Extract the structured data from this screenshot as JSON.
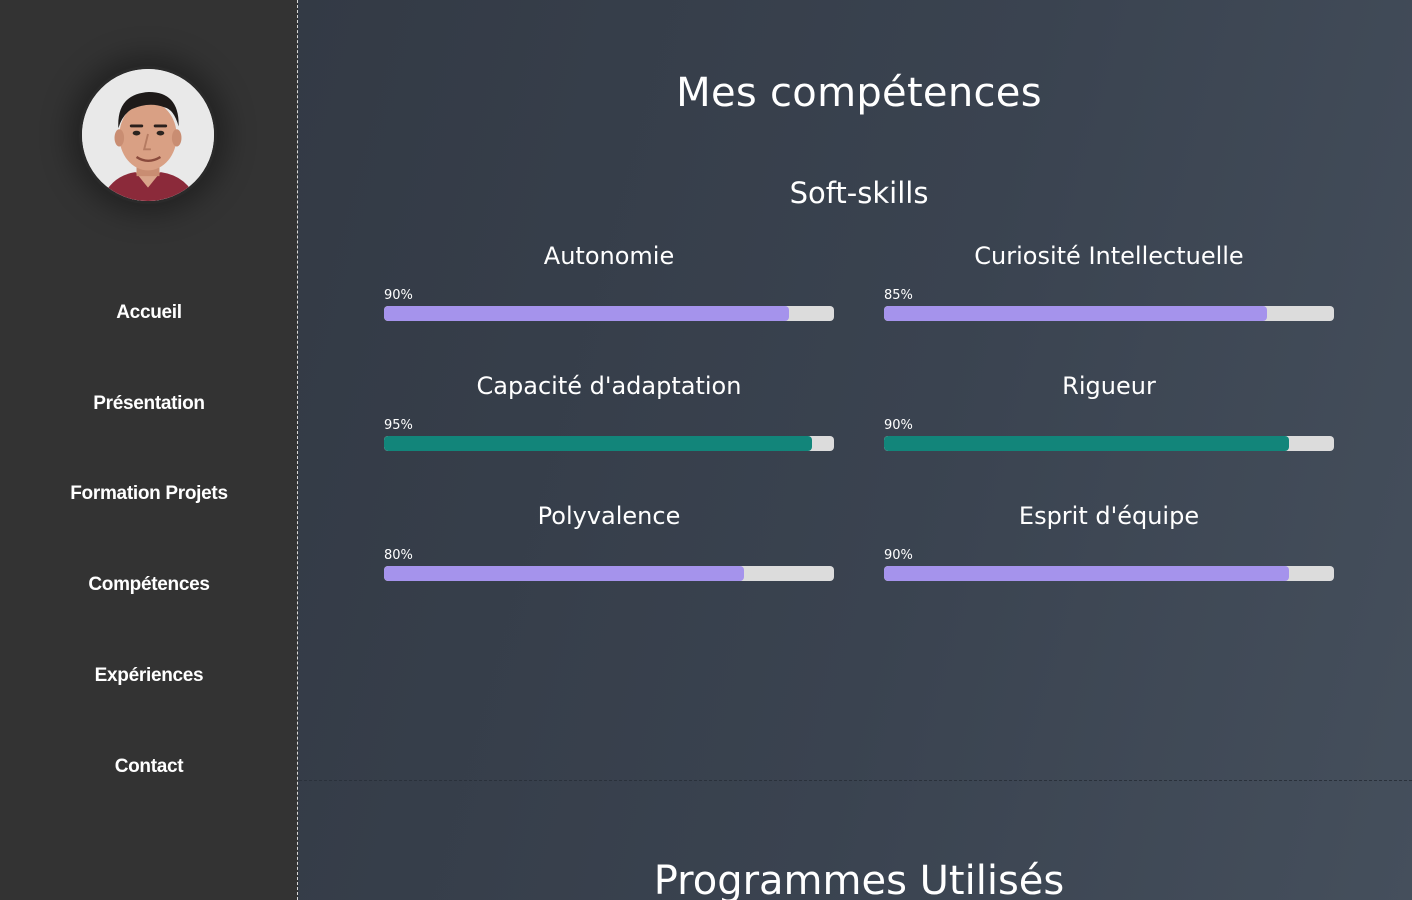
{
  "sidebar": {
    "avatar": "profile-photo",
    "items": [
      {
        "label": "Accueil"
      },
      {
        "label": "Présentation"
      },
      {
        "label": "Formation Projets"
      },
      {
        "label": "Compétences"
      },
      {
        "label": "Expériences"
      },
      {
        "label": "Contact"
      }
    ]
  },
  "main": {
    "title": "Mes compétences",
    "subtitle": "Soft-skills",
    "skills": [
      {
        "name": "Autonomie",
        "percent_label": "90%",
        "value": 90,
        "color": "#a593ec"
      },
      {
        "name": "Curiosité Intellectuelle",
        "percent_label": "85%",
        "value": 85,
        "color": "#a593ec"
      },
      {
        "name": "Capacité d'adaptation",
        "percent_label": "95%",
        "value": 95,
        "color": "#12857a"
      },
      {
        "name": "Rigueur",
        "percent_label": "90%",
        "value": 90,
        "color": "#12857a"
      },
      {
        "name": "Polyvalence",
        "percent_label": "80%",
        "value": 80,
        "color": "#a593ec"
      },
      {
        "name": "Esprit d'équipe",
        "percent_label": "90%",
        "value": 90,
        "color": "#a593ec"
      }
    ],
    "next_section_title": "Programmes Utilisés"
  },
  "colors": {
    "sidebar_bg": "#333333",
    "main_bg": "#3a4350",
    "bar_track": "#dcdcdc",
    "accent_purple": "#a593ec",
    "accent_teal": "#12857a"
  }
}
